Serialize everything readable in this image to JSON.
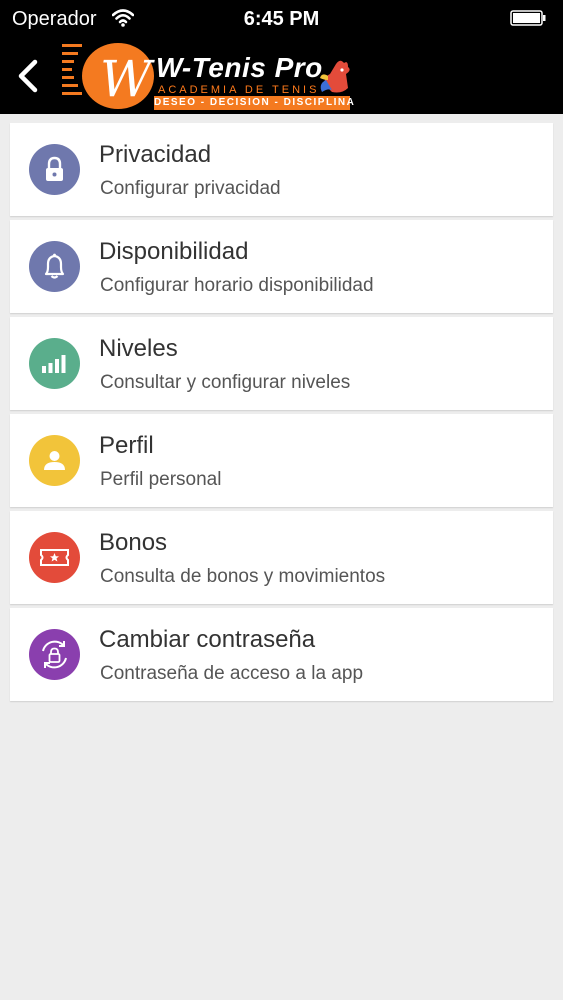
{
  "status_bar": {
    "carrier": "Operador",
    "time": "6:45 PM",
    "wifi_icon": "wifi-icon",
    "battery_icon": "battery-icon"
  },
  "nav": {
    "back_icon": "chevron-left-icon",
    "logo": {
      "title": "W-Tenis Pro",
      "subtitle": "ACADEMIA DE TENIS",
      "tagline": "DESEO - DECISION - DISCIPLINA"
    }
  },
  "menu": {
    "items": [
      {
        "title": "Privacidad",
        "subtitle": "Configurar privacidad",
        "icon": "lock-icon",
        "color": "#6f78ad"
      },
      {
        "title": "Disponibilidad",
        "subtitle": "Configurar horario disponibilidad",
        "icon": "bell-icon",
        "color": "#6f78ad"
      },
      {
        "title": "Niveles",
        "subtitle": "Consultar y configurar niveles",
        "icon": "signal-bars-icon",
        "color": "#5aae8c"
      },
      {
        "title": "Perfil",
        "subtitle": "Perfil personal",
        "icon": "user-icon",
        "color": "#f2c43a"
      },
      {
        "title": "Bonos",
        "subtitle": "Consulta de bonos y movimientos",
        "icon": "ticket-icon",
        "color": "#e34b3a"
      },
      {
        "title": "Cambiar contraseña",
        "subtitle": "Contraseña de acceso a la app",
        "icon": "lock-refresh-icon",
        "color": "#8a3fae"
      }
    ]
  }
}
